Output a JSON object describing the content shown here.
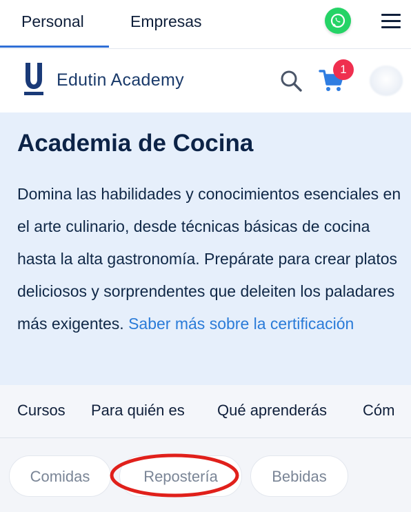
{
  "top_tabs": {
    "personal": "Personal",
    "empresas": "Empresas"
  },
  "header": {
    "whatsapp_icon": "whatsapp-icon",
    "menu_icon": "hamburger-menu-icon",
    "brand_name": "Edutin Academy",
    "search_icon": "search-icon",
    "cart_icon": "cart-icon",
    "cart_count": "1"
  },
  "hero": {
    "title": "Academia de Cocina",
    "description": "Domina las habilidades y conocimientos esenciales en el arte culinario, desde técnicas básicas de cocina hasta la alta gastronomía. Prepárate para crear platos deliciosos y sorprendentes que deleiten los paladares más exigentes.",
    "link": "Saber más sobre la certificación"
  },
  "subnav": {
    "items": [
      "Cursos",
      "Para quién es",
      "Qué aprenderás",
      "Cóm"
    ]
  },
  "chips": {
    "items": [
      "Comidas",
      "Repostería",
      "Bebidas"
    ]
  },
  "colors": {
    "accent": "#2f6fd6",
    "badge": "#ef2f4f",
    "highlight": "#e0201b",
    "hero_bg": "#e6effb"
  }
}
